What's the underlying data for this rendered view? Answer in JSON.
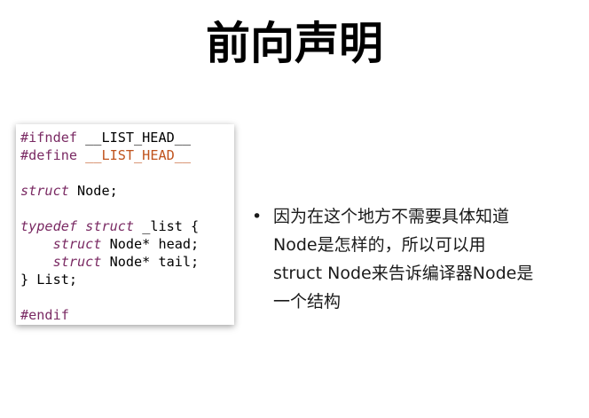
{
  "slide": {
    "title": "前向声明"
  },
  "code": {
    "lines": [
      {
        "parts": [
          {
            "t": "#ifndef",
            "c": "pp"
          },
          {
            "t": " __LIST_HEAD__",
            "c": "plain"
          }
        ]
      },
      {
        "parts": [
          {
            "t": "#define",
            "c": "pp"
          },
          {
            "t": " ",
            "c": "plain"
          },
          {
            "t": "__LIST_HEAD__",
            "c": "macro"
          }
        ]
      },
      {
        "parts": []
      },
      {
        "parts": [
          {
            "t": "struct",
            "c": "kw"
          },
          {
            "t": " Node;",
            "c": "plain"
          }
        ]
      },
      {
        "parts": []
      },
      {
        "parts": [
          {
            "t": "typedef",
            "c": "kw"
          },
          {
            "t": " ",
            "c": "plain"
          },
          {
            "t": "struct",
            "c": "kw"
          },
          {
            "t": " _list {",
            "c": "plain"
          }
        ]
      },
      {
        "parts": [
          {
            "t": "    ",
            "c": "plain"
          },
          {
            "t": "struct",
            "c": "kw"
          },
          {
            "t": " Node* head;",
            "c": "plain"
          }
        ]
      },
      {
        "parts": [
          {
            "t": "    ",
            "c": "plain"
          },
          {
            "t": "struct",
            "c": "kw"
          },
          {
            "t": " Node* tail;",
            "c": "plain"
          }
        ]
      },
      {
        "parts": [
          {
            "t": "} List;",
            "c": "plain"
          }
        ]
      },
      {
        "parts": []
      },
      {
        "parts": [
          {
            "t": "#endif",
            "c": "pp"
          }
        ]
      }
    ]
  },
  "bullet": {
    "marker": "•",
    "lines": [
      "因为在这个地方不需要具体知道",
      "Node是怎样的，所以可以用",
      "struct Node来告诉编译器Node是",
      "一个结构"
    ]
  }
}
